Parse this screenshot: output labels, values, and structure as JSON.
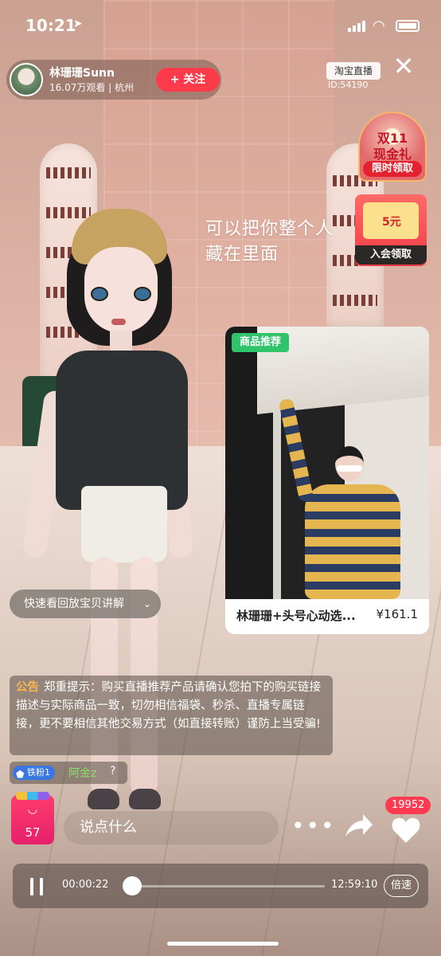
{
  "status_bar": {
    "time": "10:21",
    "location_icon": "location-arrow-icon",
    "signal_icon": "cellular-signal-icon",
    "wifi_icon": "wifi-icon",
    "battery_icon": "battery-icon"
  },
  "host": {
    "name": "林珊珊Sunn",
    "meta": "16.07万观看 | 杭州",
    "follow_label": "+ 关注"
  },
  "header": {
    "platform_tag": "淘宝直播",
    "room_id": "ID:54190",
    "close_icon": "close-icon"
  },
  "promos": {
    "cash_gift": {
      "line1": "双11",
      "line2": "现金礼",
      "tag": "限时领取"
    },
    "member_coupon": {
      "value": "5元",
      "tag": "入会领取"
    }
  },
  "overlay_caption": [
    "可以把你整个人",
    "藏在里面"
  ],
  "product": {
    "badge": "商品推荐",
    "title": "林珊珊+头号心动选...",
    "price": "¥161.1"
  },
  "replay_pill": {
    "label": "快速看回放宝贝讲解",
    "icon": "chevron-down-icon"
  },
  "notice": {
    "tag": "公告",
    "text": "郑重提示：购买直播推荐产品请确认您拍下的购买链接描述与实际商品一致，切勿相信福袋、秒杀、直播专属链接，更不要相信其他交易方式（如直接转账）谨防上当受骗!"
  },
  "fan_message": {
    "badge": "铁粉1",
    "user": "阿金z",
    "suffix": "?"
  },
  "bottom_bar": {
    "cart_count": "57",
    "comment_placeholder": "说点什么",
    "more_icon": "more-dots-icon",
    "share_icon": "share-arrow-icon",
    "like_icon": "heart-icon",
    "like_count": "19952"
  },
  "player": {
    "elapsed": "00:00:22",
    "total": "12:59:10",
    "speed_label": "倍速",
    "progress_fraction": 0.0005
  },
  "colors": {
    "accent_red": "#ff3a4a",
    "badge_green": "#2fc46a",
    "fan_blue": "#3b77e0"
  }
}
